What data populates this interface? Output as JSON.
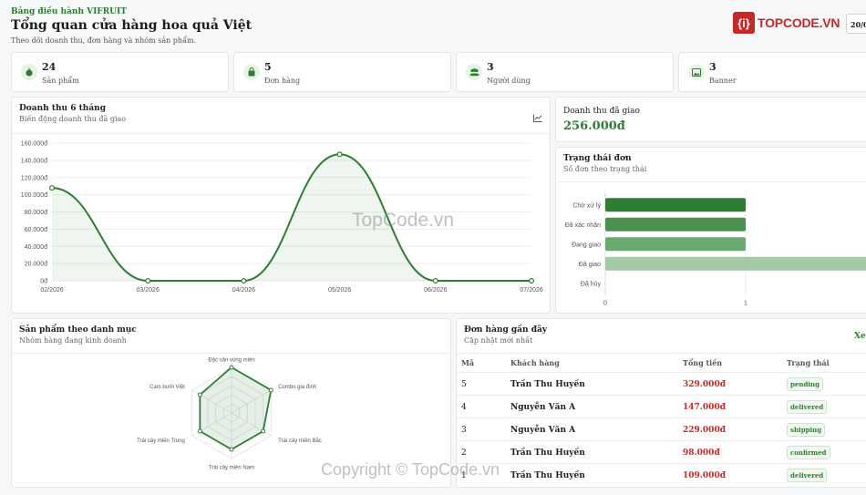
{
  "header": {
    "eyebrow": "Bảng điều hành VIFRUIT",
    "title": "Tổng quan cửa hàng hoa quả Việt",
    "subtitle": "Theo dõi doanh thu, đơn hàng và nhóm sản phẩm.",
    "date_partial": "20/0"
  },
  "logo": {
    "mark": "{i}",
    "text": "TOPCODE.VN"
  },
  "stats": [
    {
      "value": "24",
      "label": "Sản phẩm",
      "icon": "apple-icon"
    },
    {
      "value": "5",
      "label": "Đơn hàng",
      "icon": "bag-icon"
    },
    {
      "value": "3",
      "label": "Người dùng",
      "icon": "users-icon"
    },
    {
      "value": "3",
      "label": "Banner",
      "icon": "image-icon"
    }
  ],
  "revenue_card": {
    "title": "Doanh thu 6 tháng",
    "subtitle": "Biến động doanh thu đã giao",
    "icon": "line-chart-icon"
  },
  "delivered_card": {
    "label": "Doanh thu đã giao",
    "value": "256.000đ"
  },
  "status_card": {
    "title": "Trạng thái đơn",
    "subtitle": "Số đơn theo trạng thái"
  },
  "category_card": {
    "title": "Sản phẩm theo danh mục",
    "subtitle": "Nhóm hàng đang kinh doanh"
  },
  "orders_card": {
    "title": "Đơn hàng gần đây",
    "subtitle": "Cập nhật mới nhất",
    "link_partial": "Xem",
    "columns": [
      "Mã",
      "Khách hàng",
      "Tổng tiền",
      "Trạng thái"
    ],
    "rows": [
      {
        "id": "5",
        "customer": "Trần Thu Huyền",
        "total": "329.000đ",
        "status": "pending"
      },
      {
        "id": "4",
        "customer": "Nguyễn Văn A",
        "total": "147.000đ",
        "status": "delivered"
      },
      {
        "id": "3",
        "customer": "Nguyễn Văn A",
        "total": "229.000đ",
        "status": "shipping"
      },
      {
        "id": "2",
        "customer": "Trần Thu Huyền",
        "total": "98.000đ",
        "status": "confirmed"
      },
      {
        "id": "1",
        "customer": "Trần Thu Huyền",
        "total": "109.000đ",
        "status": "delivered"
      }
    ]
  },
  "watermarks": {
    "center": "TopCode.vn",
    "bottom": "Copyright © TopCode.vn"
  },
  "colors": {
    "primary": "#2f7d32",
    "accent_red": "#c62828"
  },
  "chart_data": [
    {
      "type": "area",
      "title": "Doanh thu 6 tháng",
      "categories": [
        "02/2026",
        "03/2026",
        "04/2026",
        "05/2026",
        "06/2026",
        "07/2026"
      ],
      "values": [
        108000,
        0,
        0,
        147000,
        0,
        0
      ],
      "ylim": [
        0,
        160000
      ],
      "yticks": [
        "0đ",
        "20.000đ",
        "40.000đ",
        "60.000đ",
        "80.000đ",
        "100.000đ",
        "120.000đ",
        "140.000đ",
        "160.000đ"
      ],
      "ytick_values": [
        0,
        20000,
        40000,
        60000,
        80000,
        100000,
        120000,
        140000,
        160000
      ],
      "grid": true
    },
    {
      "type": "bar",
      "orientation": "horizontal",
      "title": "Trạng thái đơn",
      "categories": [
        "Chờ xử lý",
        "Đã xác nhận",
        "Đang giao",
        "Đã giao",
        "Đã hủy"
      ],
      "values": [
        1,
        1,
        1,
        2,
        0
      ],
      "xticks": [
        "0",
        "1"
      ],
      "colors": [
        "#2e7d32",
        "#4a9150",
        "#6aaa6f",
        "#a3caa5",
        "#c8dcc9"
      ]
    },
    {
      "type": "radar",
      "title": "Sản phẩm theo danh mục",
      "categories": [
        "Đặc sản vùng miền",
        "Combo gia đình",
        "Trái cây miền Bắc",
        "Trái cây miền Nam",
        "Trái cây miền Trung",
        "Cam bưởi Việt"
      ],
      "values": [
        5,
        5,
        4,
        4,
        4,
        4
      ],
      "rmax": 5
    }
  ]
}
